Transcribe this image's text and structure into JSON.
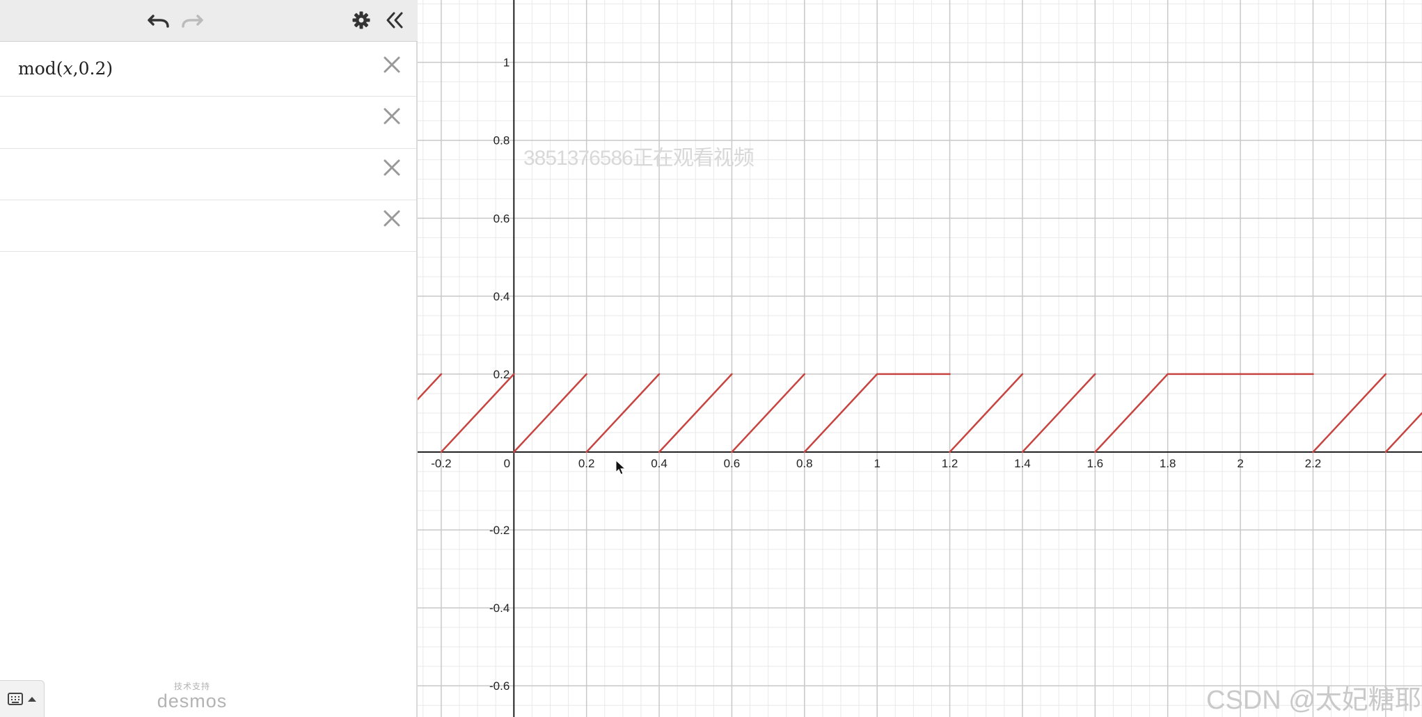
{
  "toolbar": {
    "undo_icon": "undo-arrow-icon",
    "redo_icon": "redo-arrow-icon",
    "settings_icon": "gear-icon",
    "collapse_icon": "double-chevron-left-icon"
  },
  "expressions": [
    {
      "func": "mod",
      "args_pre": "(",
      "var": "x",
      "args_post": ",0.2)"
    },
    {
      "func": "",
      "args_pre": "",
      "var": "",
      "args_post": ""
    },
    {
      "func": "",
      "args_pre": "",
      "var": "",
      "args_post": ""
    },
    {
      "func": "",
      "args_pre": "",
      "var": "",
      "args_post": ""
    }
  ],
  "footer": {
    "keyboard_icon": "keyboard-icon",
    "powered_small": "技术支持",
    "brand": "desmos"
  },
  "watermarks": {
    "top": "3851376586正在观看视频",
    "bottom": "CSDN @太妃糖耶"
  },
  "colors": {
    "curve": "#c74440",
    "axis": "#222222",
    "grid_major": "#c8c8c8",
    "grid_minor": "#e9e9e9"
  },
  "chart_data": {
    "type": "line",
    "expression": "mod(x,0.2)",
    "period": 0.2,
    "amplitude_max": 0.2,
    "xlim": [
      -0.265,
      2.5
    ],
    "ylim": [
      -0.68,
      1.16
    ],
    "x_tick_labels": [
      "-0.2",
      "0",
      "0.2",
      "0.4",
      "0.6",
      "0.8",
      "1",
      "1.2",
      "1.4",
      "1.6",
      "1.8",
      "2",
      "2.2"
    ],
    "y_tick_labels": [
      "1",
      "0.8",
      "0.6",
      "0.4",
      "0.2",
      "-0.2",
      "-0.4",
      "-0.6"
    ],
    "grid": true
  }
}
